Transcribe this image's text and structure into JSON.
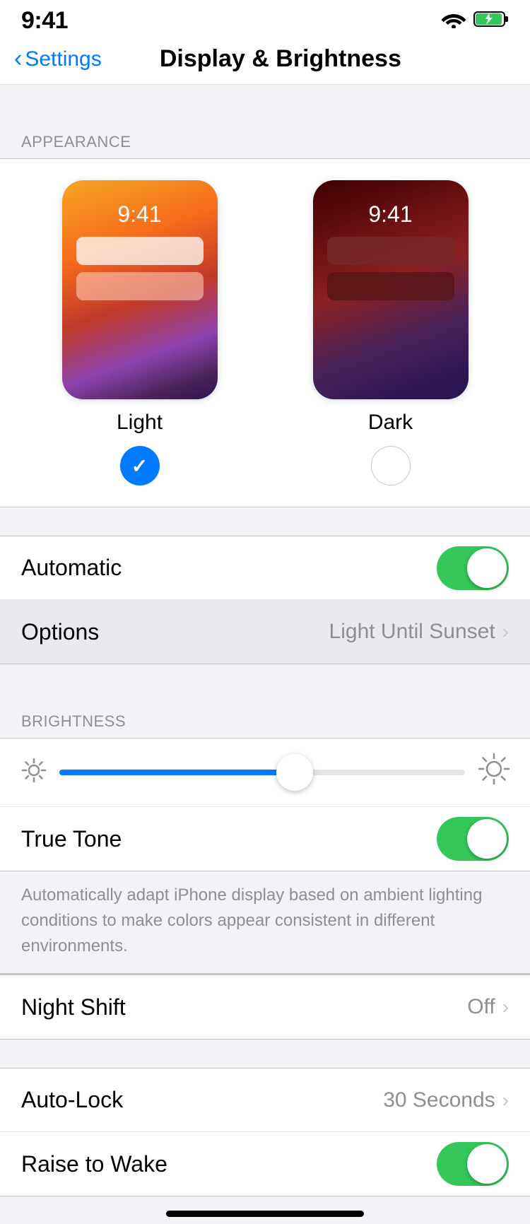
{
  "statusBar": {
    "time": "9:41"
  },
  "navBar": {
    "backLabel": "Settings",
    "title": "Display & Brightness"
  },
  "appearance": {
    "sectionLabel": "APPEARANCE",
    "lightOption": {
      "label": "Light",
      "time": "9:41",
      "selected": true
    },
    "darkOption": {
      "label": "Dark",
      "time": "9:41",
      "selected": false
    }
  },
  "automatic": {
    "label": "Automatic",
    "enabled": true
  },
  "options": {
    "label": "Options",
    "value": "Light Until Sunset"
  },
  "brightness": {
    "sectionLabel": "BRIGHTNESS",
    "sliderPercent": 58
  },
  "trueTone": {
    "label": "True Tone",
    "enabled": true,
    "footnote": "Automatically adapt iPhone display based on ambient lighting conditions to make colors appear consistent in different environments."
  },
  "nightShift": {
    "label": "Night Shift",
    "value": "Off"
  },
  "autoLock": {
    "label": "Auto-Lock",
    "value": "30 Seconds"
  },
  "raiseToWake": {
    "label": "Raise to Wake",
    "enabled": true
  }
}
